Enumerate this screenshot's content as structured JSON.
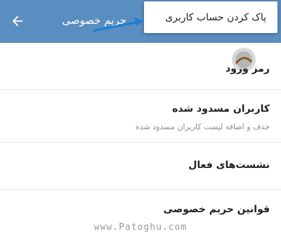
{
  "header": {
    "title": "حریم خصوصی",
    "bg_color": "#5b8ec0",
    "back_icon": "arrow-back-icon"
  },
  "popup": {
    "label": "پاک کردن حساب کاربری"
  },
  "items": [
    {
      "title": "رمز ورود"
    },
    {
      "title": "کاربران مسدود شده",
      "subtitle": "حذف و اضافه لیست کاربران مسدود شده"
    },
    {
      "title": "نشست‌های فعال"
    },
    {
      "title": "قوانین حریم خصوصی"
    }
  ],
  "watermark": "www.Patoghu.com",
  "accent_color": "#1a7fd6"
}
